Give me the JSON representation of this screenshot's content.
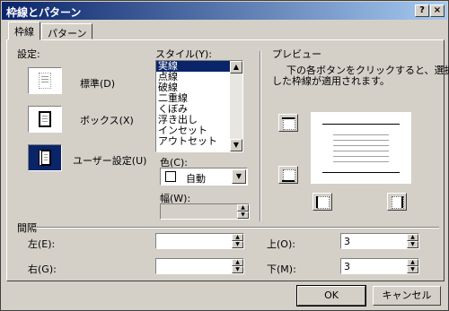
{
  "window": {
    "title": "枠線とパターン",
    "help_glyph": "?",
    "close_glyph": "×"
  },
  "tabs": [
    {
      "label": "枠線"
    },
    {
      "label": "パターン"
    }
  ],
  "settings": {
    "label": "設定:",
    "presets": [
      {
        "label": "標準(D)"
      },
      {
        "label": "ボックス(X)"
      },
      {
        "label": "ユーザー設定(U)"
      }
    ]
  },
  "style": {
    "label": "スタイル(Y):",
    "items": [
      "実線",
      "点線",
      "破線",
      "二重線",
      "くぼみ",
      "浮き出し",
      "インセット",
      "アウトセット"
    ],
    "selected_index": 0,
    "color_label": "色(C):",
    "color_value": "自動",
    "width_label": "幅(W):",
    "width_value": ""
  },
  "preview": {
    "label": "プレビュー",
    "hint_line1": "下の各ボタンをクリックすると、選択",
    "hint_line2": "した枠線が適用されます。"
  },
  "spacing": {
    "label": "間隔",
    "left_label": "左(E):",
    "left_value": "",
    "right_label": "右(G):",
    "right_value": "",
    "top_label": "上(O):",
    "top_value": "3",
    "bottom_label": "下(M):",
    "bottom_value": "3"
  },
  "buttons": {
    "ok": "OK",
    "cancel": "キャンセル"
  },
  "colors": {
    "title_start": "#0a246a",
    "title_end": "#a6caf0",
    "face": "#d4d0c8",
    "selection": "#0a246a"
  }
}
